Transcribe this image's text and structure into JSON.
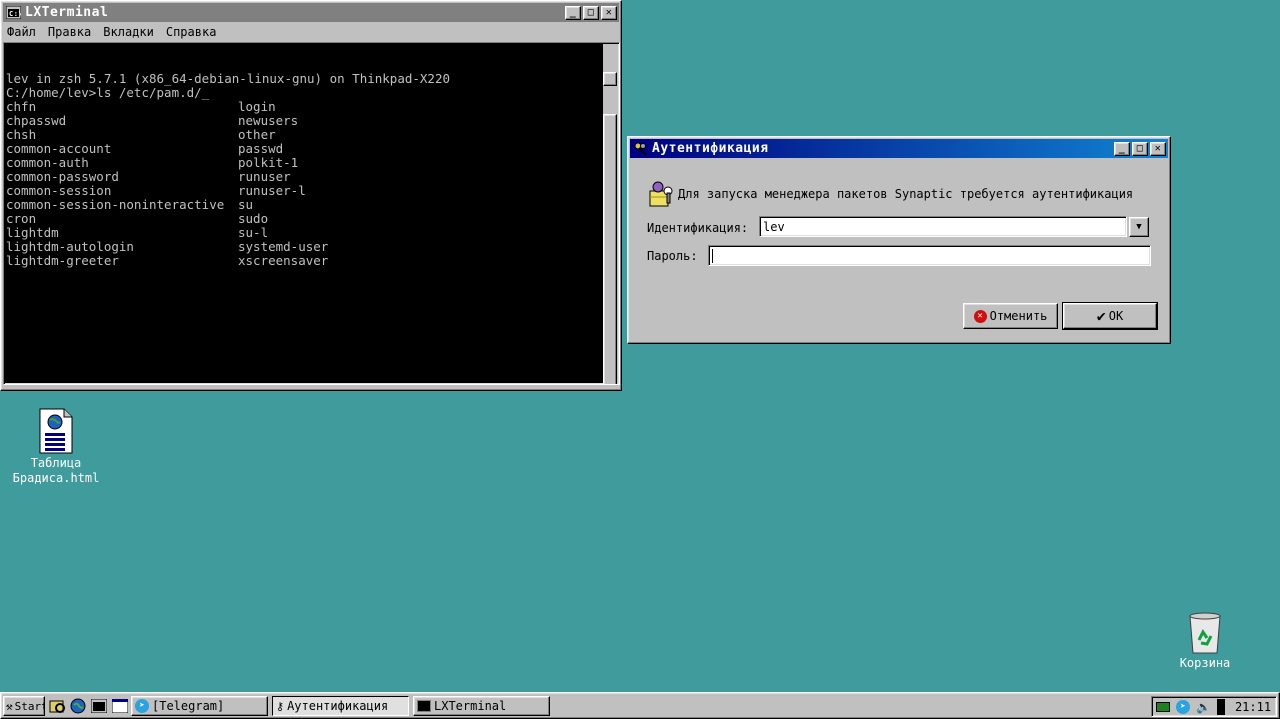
{
  "terminal": {
    "title": "LXTerminal",
    "menu": [
      "Файл",
      "Правка",
      "Вкладки",
      "Справка"
    ],
    "lines": [
      {
        "a": "lev in zsh 5.7.1 (x86_64-debian-linux-gnu) on Thinkpad-X220",
        "b": ""
      },
      {
        "a": "C:/home/lev>ls /etc/pam.d/_",
        "b": ""
      },
      {
        "a": "chfn",
        "b": "login"
      },
      {
        "a": "chpasswd",
        "b": "newusers"
      },
      {
        "a": "chsh",
        "b": "other"
      },
      {
        "a": "common-account",
        "b": "passwd"
      },
      {
        "a": "common-auth",
        "b": "polkit-1"
      },
      {
        "a": "common-password",
        "b": "runuser"
      },
      {
        "a": "common-session",
        "b": "runuser-l"
      },
      {
        "a": "common-session-noninteractive",
        "b": "su"
      },
      {
        "a": "cron",
        "b": "sudo"
      },
      {
        "a": "lightdm",
        "b": "su-l"
      },
      {
        "a": "lightdm-autologin",
        "b": "systemd-user"
      },
      {
        "a": "lightdm-greeter",
        "b": "xscreensaver"
      }
    ]
  },
  "auth_dialog": {
    "title": "Аутентификация",
    "message": "Для запуска менеджера пакетов Synaptic требуется аутентификация",
    "identity_label": "Идентификация:",
    "identity_value": "lev",
    "password_label": "Пароль:",
    "password_value": "",
    "cancel_label": "Отменить",
    "ok_label": "OK"
  },
  "desktop": {
    "icons": [
      {
        "label_line1": "Таблица",
        "label_line2": "Брадиса.html"
      },
      {
        "label_line1": "Корзина"
      }
    ]
  },
  "taskbar": {
    "start_label": "Start",
    "tasks": [
      "[Telegram]",
      "Аутентификация",
      "LXTerminal"
    ],
    "clock": "21:11"
  },
  "colors": {
    "desktop": "#3f9b9c",
    "title_active": "#000080",
    "title_inactive": "#808080",
    "face": "#c0c0c0"
  }
}
